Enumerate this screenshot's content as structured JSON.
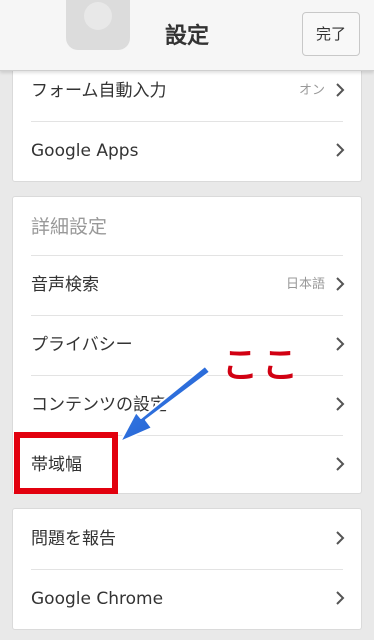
{
  "header": {
    "title": "設定",
    "done_label": "完了"
  },
  "cards": {
    "top": {
      "rows": [
        {
          "label": "フォーム自動入力",
          "value": "オン"
        },
        {
          "label": "Google Apps"
        }
      ]
    },
    "advanced": {
      "header": "詳細設定",
      "rows": [
        {
          "label": "音声検索",
          "value": "日本語"
        },
        {
          "label": "プライバシー"
        },
        {
          "label": "コンテンツの設定"
        },
        {
          "label": "帯域幅"
        }
      ]
    },
    "bottom": {
      "rows": [
        {
          "label": "問題を報告"
        },
        {
          "label": "Google Chrome"
        }
      ]
    }
  },
  "annotation": {
    "callout_text": "ここ",
    "colors": {
      "box": "#e2000e",
      "text": "#d10012",
      "arrow": "#1a5fd0"
    }
  }
}
